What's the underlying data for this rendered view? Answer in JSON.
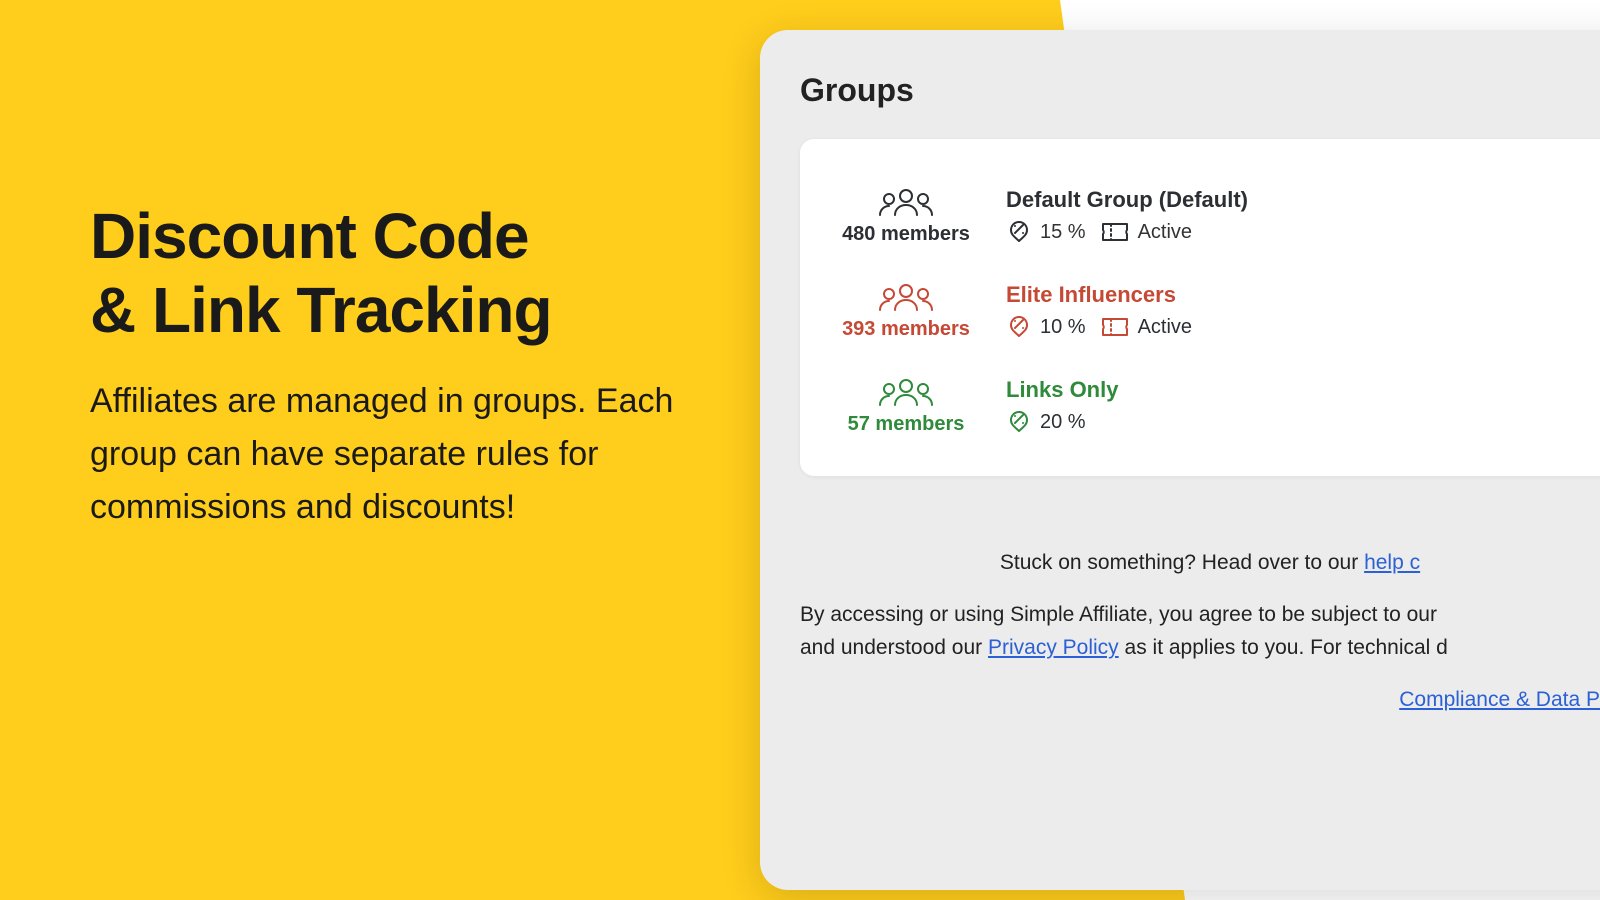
{
  "marketing": {
    "title_line1": "Discount Code",
    "title_line2": "& Link Tracking",
    "subtitle": "Affiliates are managed in groups. Each group can have separate rules for commissions and discounts!"
  },
  "panel": {
    "title": "Groups"
  },
  "groups": [
    {
      "members": "480 members",
      "name": "Default Group (Default)",
      "commission": "15 %",
      "status": "Active",
      "tone": "dark",
      "show_ticket": true
    },
    {
      "members": "393 members",
      "name": "Elite Influencers",
      "commission": "10 %",
      "status": "Active",
      "tone": "red",
      "show_ticket": true
    },
    {
      "members": "57 members",
      "name": "Links Only",
      "commission": "20 %",
      "status": "",
      "tone": "green",
      "show_ticket": false
    }
  ],
  "footer": {
    "help_lead": "Stuck on something? Head over to our ",
    "help_link": "help c",
    "legal_1a": "By accessing or using Simple Affiliate, you agree to be subject to our ",
    "legal_1b": " and understood our ",
    "privacy": "Privacy Policy",
    "legal_1c": " as it applies to you. For technical d",
    "compliance": "Compliance & Data P"
  }
}
